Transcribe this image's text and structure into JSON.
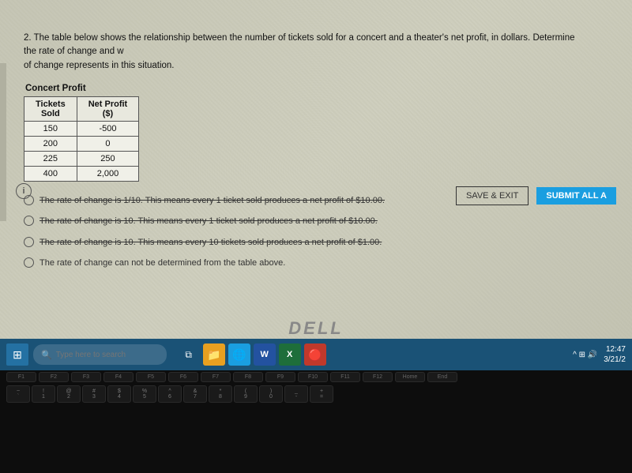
{
  "question": {
    "number": "2.",
    "text": "The table below shows the relationship between the number of tickets sold for a concert and a theater's net profit, in dollars.  Determine the rate of change and w",
    "subtext": "of change represents in this situation."
  },
  "table": {
    "title": "Concert Profit",
    "headers": [
      "Tickets Sold",
      "Net Profit ($)"
    ],
    "rows": [
      {
        "tickets": "150",
        "profit": "-500"
      },
      {
        "tickets": "200",
        "profit": "0"
      },
      {
        "tickets": "225",
        "profit": "250"
      },
      {
        "tickets": "400",
        "profit": "2,000"
      }
    ]
  },
  "options": [
    {
      "id": "A",
      "text": "The rate of change is 1/10.  This means every 1 ticket sold produces a net profit of $10.00.",
      "strikethrough": true
    },
    {
      "id": "B",
      "text": "The rate of change is 10.  This means every 1 ticket sold produces a net profit of $10.00.",
      "strikethrough": true
    },
    {
      "id": "C",
      "text": "The rate of change is 10.  This means every 10 tickets sold produces a net profit of $1.00.",
      "strikethrough": true
    },
    {
      "id": "D",
      "text": "The rate of change can not be determined from the table above.",
      "strikethrough": false
    }
  ],
  "buttons": {
    "save_exit": "SAVE & EXIT",
    "submit": "SUBMIT ALL A"
  },
  "taskbar": {
    "search_placeholder": "Type here to search",
    "time": "12:47",
    "date": "3/21/2"
  },
  "keyboard": {
    "fn_keys": [
      "F1",
      "F2",
      "F3",
      "F4",
      "F5",
      "F6",
      "F7",
      "F8",
      "F9",
      "F10",
      "F11",
      "F12",
      "Home",
      "End"
    ],
    "num_keys": [
      "~\n`",
      "!\n1",
      "@\n2",
      "#\n3",
      "$\n4",
      "%\n5",
      "^\n6",
      "&\n7",
      "*\n8",
      "(\n9",
      ")\n0",
      "_\n-",
      "+\n="
    ]
  },
  "dell_logo": "DELL"
}
